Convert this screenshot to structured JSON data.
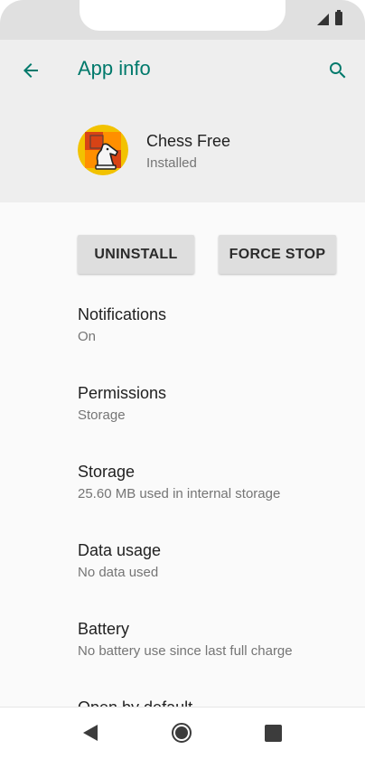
{
  "toolbar": {
    "title": "App info",
    "back_icon": "arrow-back-icon",
    "search_icon": "search-icon",
    "accent_color": "#00796b"
  },
  "app": {
    "name": "Chess Free",
    "status": "Installed",
    "icon": "chess-knight-icon"
  },
  "actions": {
    "uninstall_label": "UNINSTALL",
    "force_stop_label": "FORCE STOP"
  },
  "preferences": [
    {
      "title": "Notifications",
      "summary": "On"
    },
    {
      "title": "Permissions",
      "summary": "Storage"
    },
    {
      "title": "Storage",
      "summary": "25.60 MB used in internal storage"
    },
    {
      "title": "Data usage",
      "summary": "No data used"
    },
    {
      "title": "Battery",
      "summary": "No battery use since last full charge"
    },
    {
      "title": "Open by default",
      "summary": ""
    }
  ],
  "status_bar": {
    "icons": [
      "signal-icon",
      "battery-icon"
    ]
  },
  "nav_bar": {
    "icons": [
      "nav-back-icon",
      "nav-home-icon",
      "nav-recents-icon"
    ]
  }
}
